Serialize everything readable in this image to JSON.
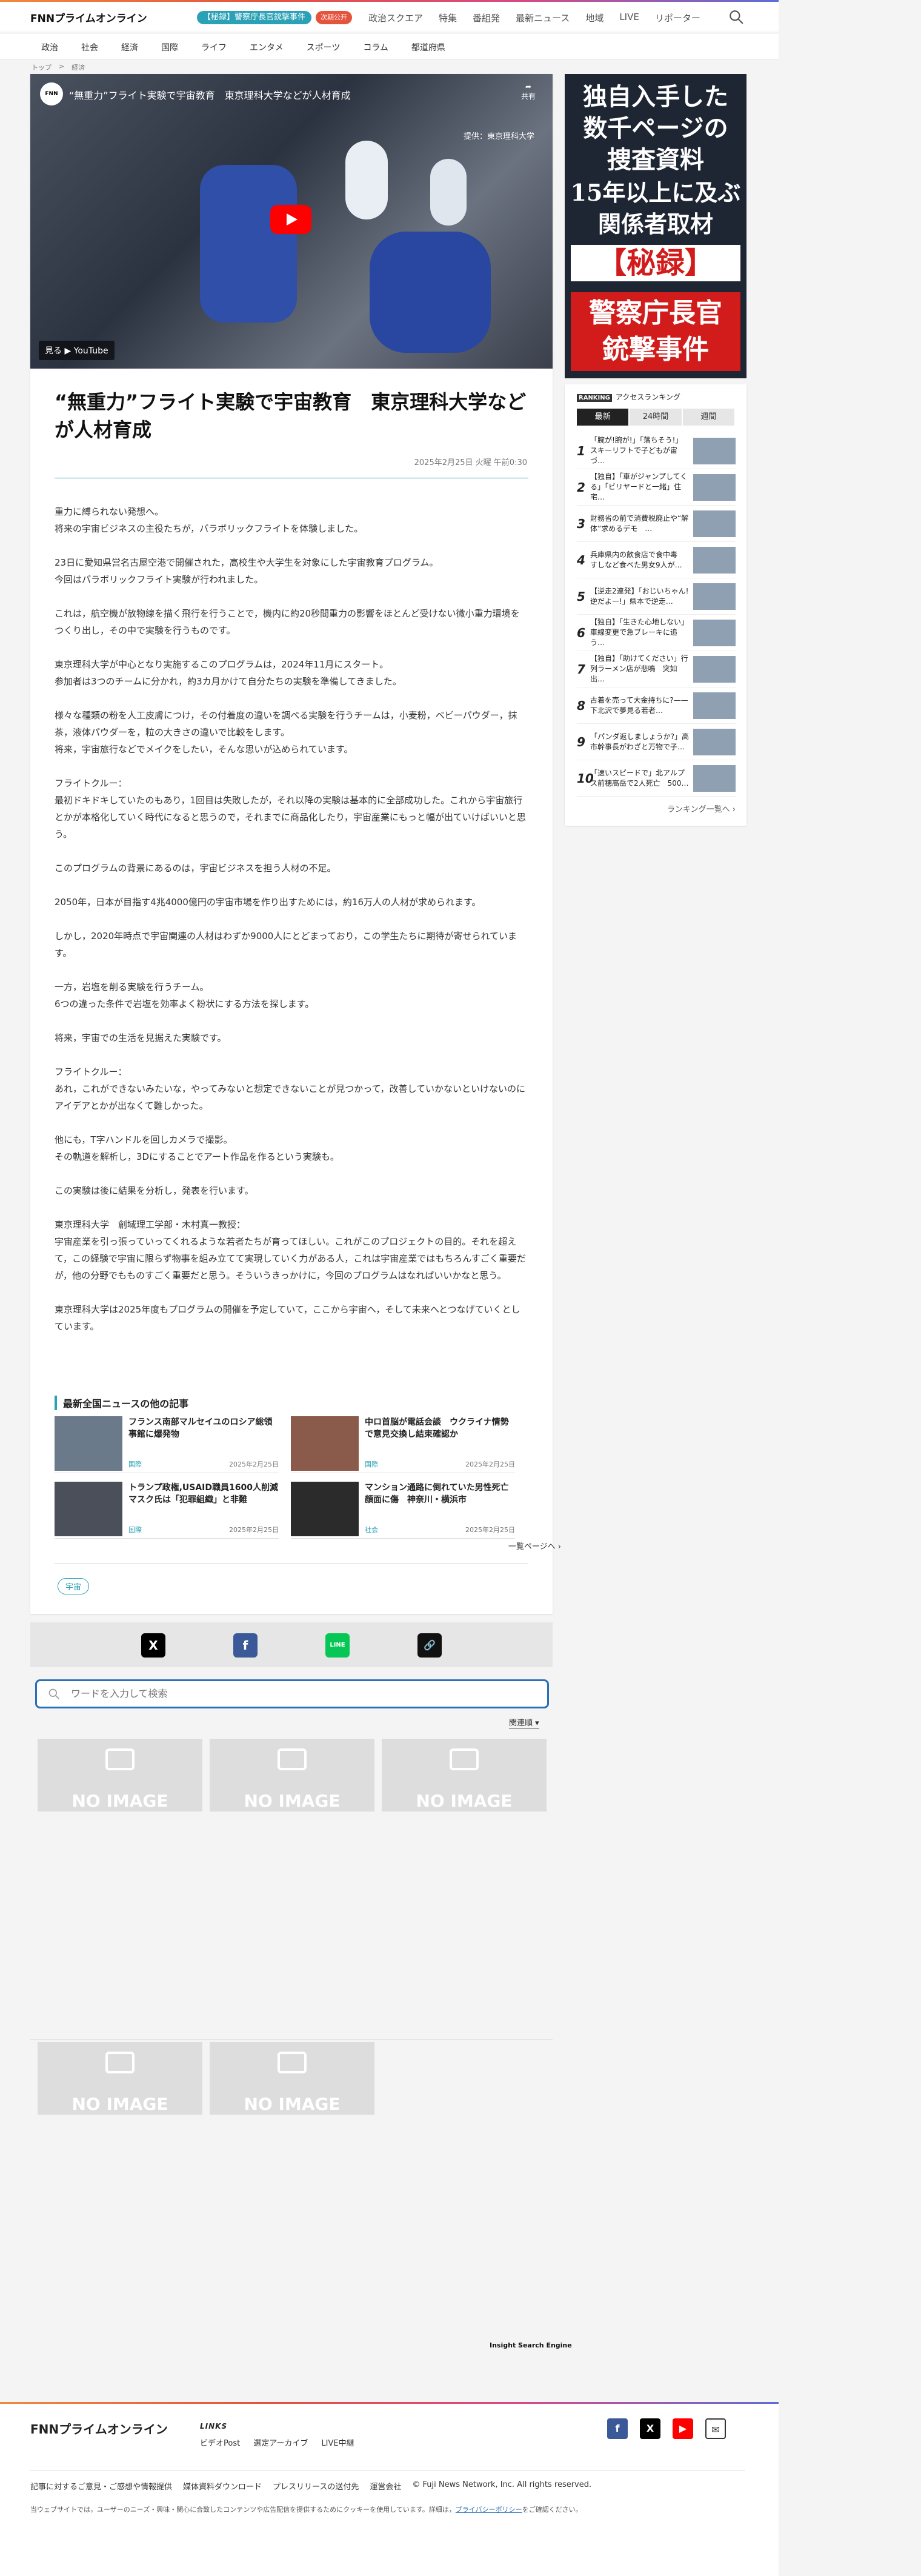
{
  "header": {
    "logo_mark": "FNN",
    "logo_text": "プライムオンライン",
    "pill_topic": "【秘録】警察庁長官銃撃事件",
    "pill_badge": "次期公开",
    "nav": [
      "政治スクエア",
      "特集",
      "番組発",
      "最新ニュース",
      "地域",
      "LIVE",
      "リポーター"
    ]
  },
  "categories": [
    "政治",
    "社会",
    "経済",
    "国際",
    "ライフ",
    "エンタメ",
    "スポーツ",
    "コラム",
    "都道府県"
  ],
  "breadcrumb": [
    "トップ",
    ">",
    "経済"
  ],
  "video": {
    "channel": "FNN",
    "title": "“無重力”フライト実験で宇宙教育　東京理科大学などが人材育成",
    "share": "共有",
    "credit": "提供：東京理科大学",
    "watch": "見る ▶ YouTube"
  },
  "article": {
    "title": "“無重力”フライト実験で宇宙教育　東京理科大学などが人材育成",
    "date": "2025年2月25日 火曜 午前0:30",
    "paragraphs": [
      "重力に縛られない発想へ。\n将来の宇宙ビジネスの主役たちが，パラボリックフライトを体験しました。",
      "23日に愛知県営名古屋空港で開催された，高校生や大学生を対象にした宇宙教育プログラム。\n今回はパラボリックフライト実験が行われました。",
      "これは，航空機が放物線を描く飛行を行うことで，機内に約20秒間重力の影響をほとんど受けない微小重力環境をつくり出し，その中で実験を行うものです。",
      "東京理科大学が中心となり実施するこのプログラムは，2024年11月にスタート。\n参加者は3つのチームに分かれ，約3カ月かけて自分たちの実験を準備してきました。",
      "様々な種類の粉を人工皮膚につけ，その付着度の違いを調べる実験を行うチームは，小麦粉，ベビーパウダー，抹茶，液体パウダーを，粒の大きさの違いで比較をします。\n将来，宇宙旅行などでメイクをしたい，そんな思いが込められています。",
      "フライトクルー：\n最初ドキドキしていたのもあり，1回目は失敗したが，それ以降の実験は基本的に全部成功した。これから宇宙旅行とかが本格化していく時代になると思うので，それまでに商品化したり，宇宙産業にもっと幅が出ていけばいいと思う。",
      "このプログラムの背景にあるのは，宇宙ビジネスを担う人材の不足。",
      "2050年，日本が目指す4兆4000億円の宇宙市場を作り出すためには，約16万人の人材が求められます。",
      "しかし，2020年時点で宇宙関連の人材はわずか9000人にとどまっており，この学生たちに期待が寄せられています。",
      "一方，岩塩を削る実験を行うチーム。\n6つの違った条件で岩塩を効率よく粉状にする方法を探します。",
      "将来，宇宙での生活を見据えた実験です。",
      "フライトクルー：\nあれ，これができないみたいな，やってみないと想定できないことが見つかって，改善していかないといけないのにアイデアとかが出なくて難しかった。",
      "他にも，T字ハンドルを回しカメラで撮影。\nその軌道を解析し，3Dにすることでアート作品を作るという実験も。",
      "この実験は後に結果を分析し，発表を行います。",
      "東京理科大学　創域理工学部・木村真一教授：\n宇宙産業を引っ張っていってくれるような若者たちが育ってほしい。これがこのプロジェクトの目的。それを超えて，この経験で宇宙に限らず物事を組み立てて実現していく力がある人，これは宇宙産業ではもちろんすごく重要だが，他の分野でもものすごく重要だと思う。そういうきっかけに，今回のプログラムはなればいいかなと思う。",
      "東京理科大学は2025年度もプログラムの開催を予定していて，ここから宇宙へ，そして未来へとつなげていくとしています。"
    ]
  },
  "other_news": {
    "heading": "最新全国ニュースの他の記事",
    "items": [
      {
        "title": "フランス南部マルセイユのロシア総領事館に爆発物",
        "category": "国際",
        "date": "2025年2月25日"
      },
      {
        "title": "中ロ首脳が電話会談　ウクライナ情勢で意見交換し結束確認か",
        "category": "国際",
        "date": "2025年2月25日"
      },
      {
        "title": "トランプ政権,USAID職員1600人削減　マスク氏は「犯罪組織」と非難",
        "category": "国際",
        "date": "2025年2月25日"
      },
      {
        "title": "マンション通路に倒れていた男性死亡　顔面に傷　神奈川・横浜市",
        "category": "社会",
        "date": "2025年2月25日"
      }
    ],
    "more": "一覧ページへ"
  },
  "tags": [
    "宇宙"
  ],
  "share": {
    "x": "X",
    "facebook": "f",
    "line": "LINE",
    "link": "🔗"
  },
  "search": {
    "placeholder": "ワードを入力して検索",
    "sort": "関連順 ▾",
    "no_image": "NO IMAGE",
    "engine": "Insight Search Engine"
  },
  "ad": {
    "line1": "独自入手した\n数千ページの\n捜査資料",
    "line2": "15年以上に及ぶ\n関係者取材",
    "line3": "【秘録】",
    "line4": "警察庁長官\n銃撃事件"
  },
  "ranking": {
    "badge": "RANKING",
    "heading": "アクセスランキング",
    "tabs": [
      "最新",
      "24時間",
      "週間"
    ],
    "items": [
      {
        "num": "1",
        "title": "「腕が!腕が!」「落ちそう!」スキーリフトで子どもが宙づ…"
      },
      {
        "num": "2",
        "title": "【独自】「車がジャンプしてくる」「ビリヤードと一緒」住宅…"
      },
      {
        "num": "3",
        "title": "財務省の前で消費税廃止や“解体”求めるデモ　…"
      },
      {
        "num": "4",
        "title": "兵庫県内の飲食店で食中毒　すしなど食べた男女9人が…"
      },
      {
        "num": "5",
        "title": "【逆走2連発】「おじいちゃん!逆だよー!」県本で逆走…"
      },
      {
        "num": "6",
        "title": "【独自】「生きた心地しない」車線変更で急ブレーキに追う…"
      },
      {
        "num": "7",
        "title": "【独自】「助けてください」行列ラーメン店が悲鳴　突如出…"
      },
      {
        "num": "8",
        "title": "古着を売って大金持ちに?——下北沢で夢見る若者…"
      },
      {
        "num": "9",
        "title": "「パンダ返しましょうか?」高市幹事長がわざと万物で子…"
      },
      {
        "num": "10",
        "title": "「速いスピードで」北アルプス前穂高岳で2人死亡　500…"
      }
    ],
    "more": "ランキング一覧へ"
  },
  "footer": {
    "logo": "FNNプライムオンライン",
    "links_heading": "LINKS",
    "links": [
      "ビデオPost",
      "選定アーカイブ",
      "LIVE中継"
    ],
    "bottom_links": [
      "記事に対するご意見・ご感想や情報提供",
      "媒体資料ダウンロード",
      "プレスリリースの送付先",
      "運営会社",
      "© Fuji News Network, Inc. All rights reserved."
    ],
    "note_prefix": "当ウェブサイトでは，ユーザーのニーズ・興味・関心に合致したコンテンツや広告配信を提供するためにクッキーを使用しています。詳細は，",
    "note_link": "プライバシーポリシー",
    "note_suffix": "をご確認ください。"
  }
}
